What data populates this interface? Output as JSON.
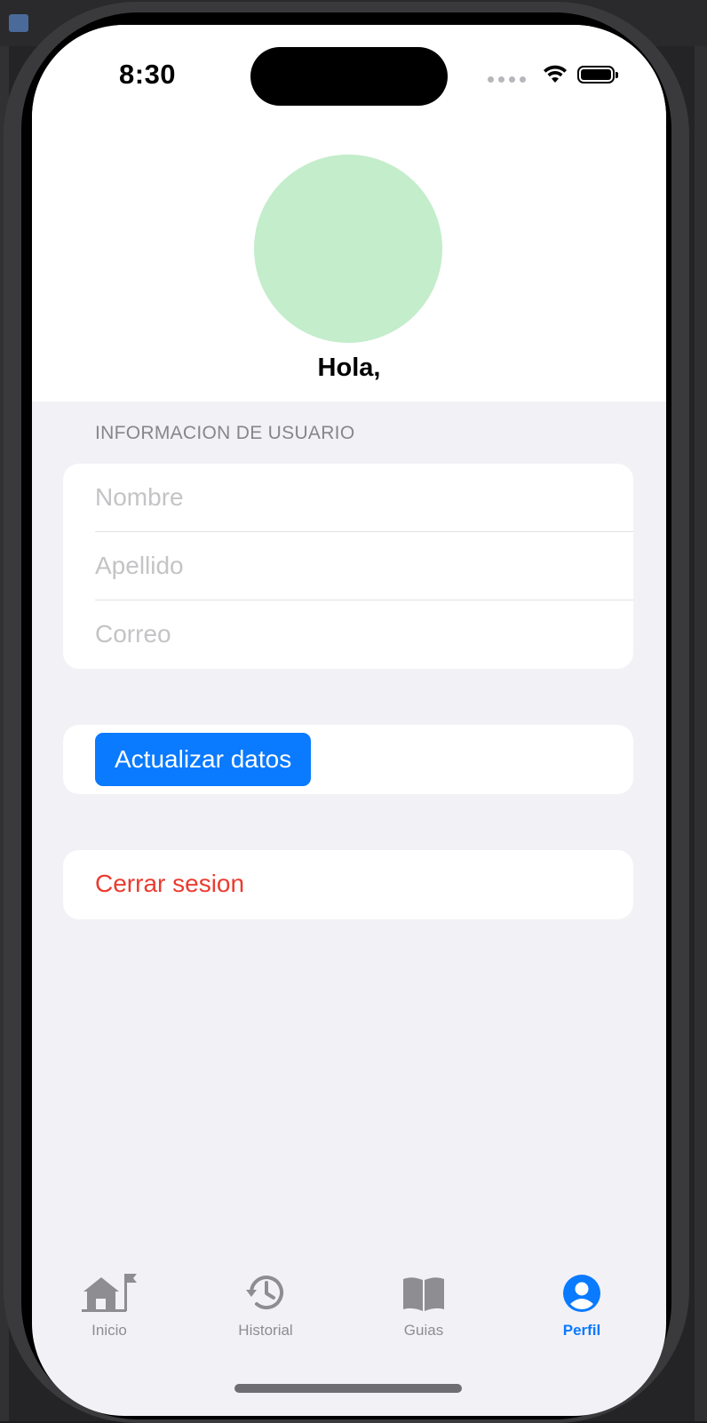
{
  "status_bar": {
    "time": "8:30"
  },
  "profile": {
    "greeting": "Hola,",
    "avatar_color": "#c3edcb"
  },
  "user_info": {
    "section_title": "INFORMACION DE USUARIO",
    "fields": [
      {
        "placeholder": "Nombre",
        "value": ""
      },
      {
        "placeholder": "Apellido",
        "value": ""
      },
      {
        "placeholder": "Correo",
        "value": ""
      }
    ]
  },
  "actions": {
    "update_label": "Actualizar datos",
    "logout_label": "Cerrar sesion"
  },
  "tabbar": {
    "items": [
      {
        "label": "Inicio",
        "icon": "home-flag-icon",
        "active": false
      },
      {
        "label": "Historial",
        "icon": "history-clock-icon",
        "active": false
      },
      {
        "label": "Guias",
        "icon": "book-icon",
        "active": false
      },
      {
        "label": "Perfil",
        "icon": "person-circle-icon",
        "active": true
      }
    ]
  },
  "colors": {
    "accent": "#0a7aff",
    "destructive": "#ea3b30",
    "background": "#f2f1f6",
    "inactive_tab": "#8d8d92"
  }
}
